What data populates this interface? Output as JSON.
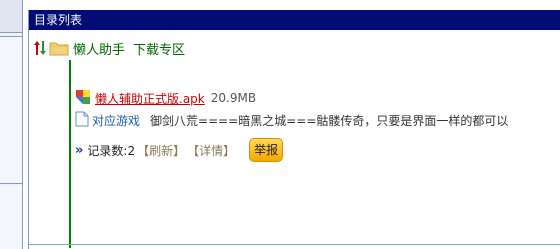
{
  "panel": {
    "title": "目录列表"
  },
  "entry": {
    "title": "懒人助手",
    "subtitle": "下载专区",
    "file": {
      "name": "懒人辅助正式版.apk",
      "size": "20.9MB"
    },
    "related": {
      "label": "对应游戏",
      "description": "御剑八荒====暗黑之城===骷髅传奇，只要是界面一样的都可以"
    },
    "stats": {
      "count_text": "记录数:2",
      "refresh_label": "【刷新】",
      "details_label": "【详情】",
      "report_label": "举报"
    }
  },
  "colors": {
    "titlebar_bg": "#000b73",
    "tree_green": "#006600",
    "file_link_red": "#cc0000",
    "report_button": "#f5a800"
  },
  "icons": [
    "sort-arrows-icon",
    "folder-icon",
    "apk-file-icon",
    "document-icon",
    "double-arrow-icon"
  ]
}
